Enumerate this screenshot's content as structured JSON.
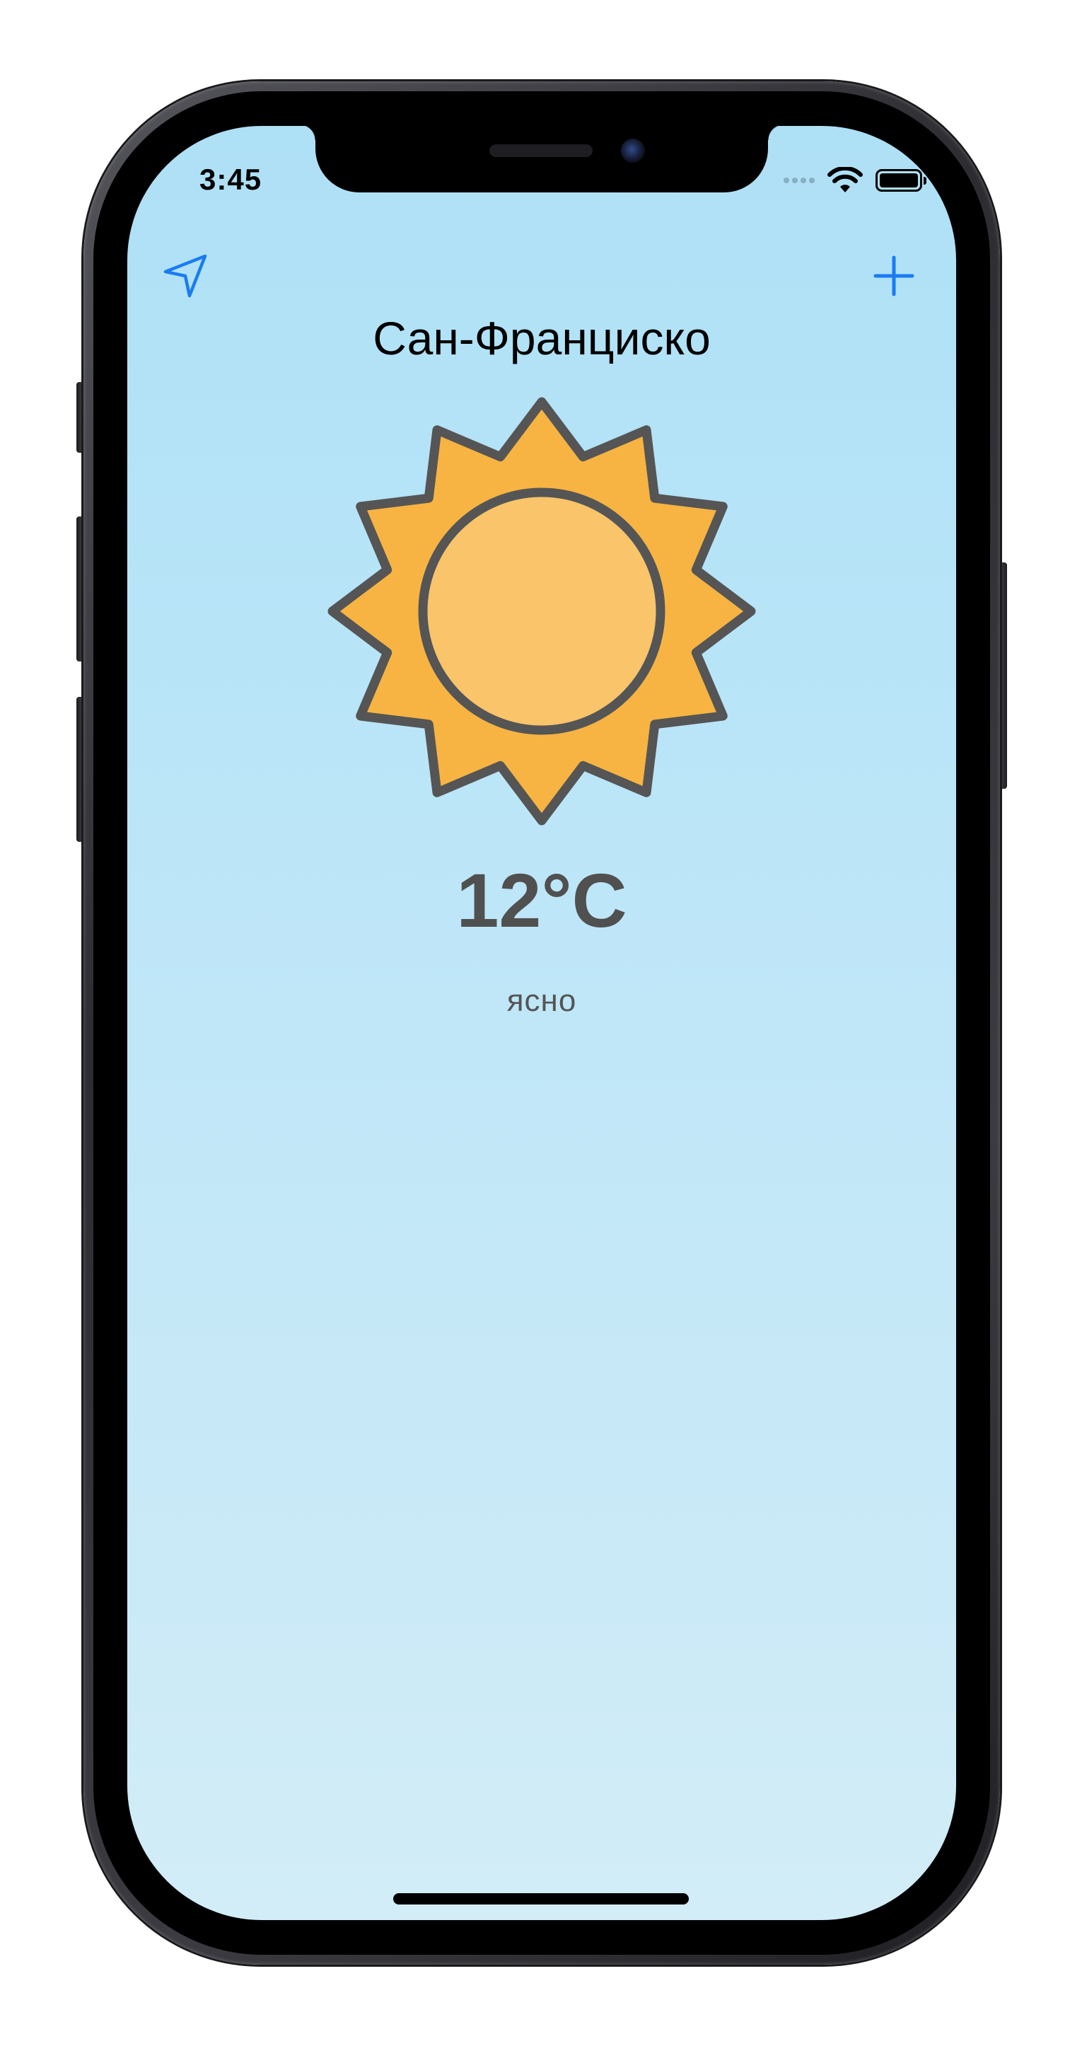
{
  "status_bar": {
    "time": "3:45"
  },
  "nav": {
    "location_icon": "location-arrow-icon",
    "add_icon": "plus-icon"
  },
  "weather": {
    "city": "Сан-Франциско",
    "temperature": "12°C",
    "condition": "ясно",
    "icon": "sun-icon"
  },
  "colors": {
    "accent": "#1a7cf2",
    "sun_rays": "#f7b442",
    "sun_core": "#f9c46a",
    "sun_outline": "#555555",
    "sky_top": "#aee0f6",
    "sky_bottom": "#d2edf7"
  }
}
